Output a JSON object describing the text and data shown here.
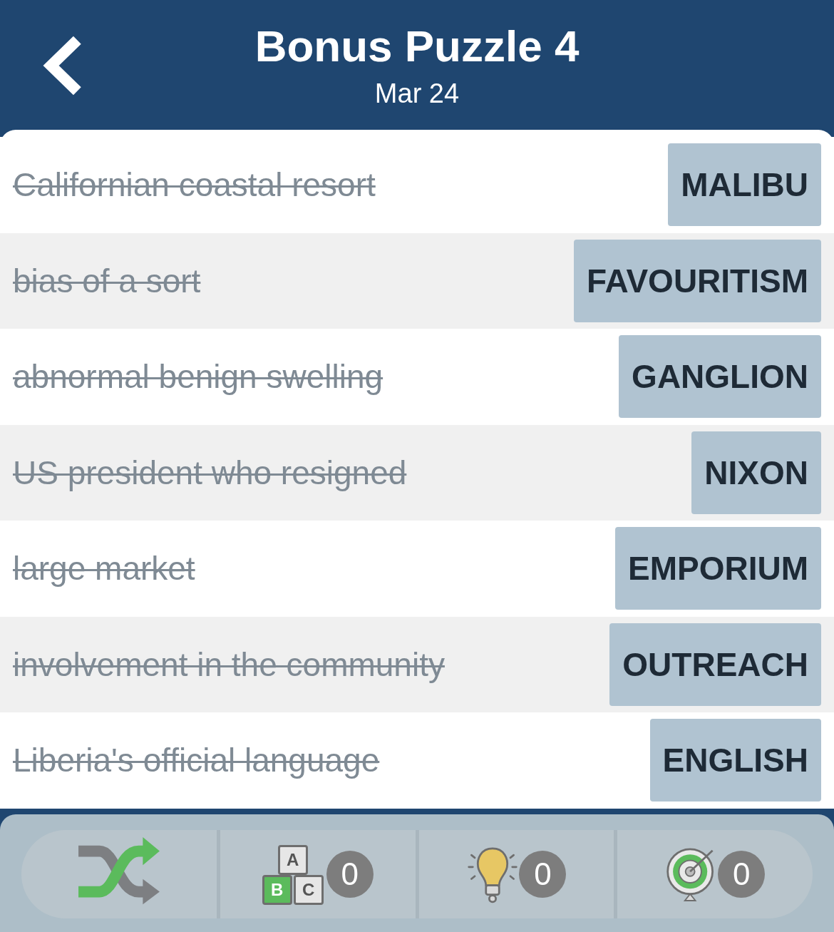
{
  "header": {
    "title": "Bonus Puzzle 4",
    "date": "Mar 24"
  },
  "clues": [
    {
      "clue": "Californian coastal resort",
      "answer": "MALIBU",
      "solved": true
    },
    {
      "clue": "bias of a sort",
      "answer": "FAVOURITISM",
      "solved": true
    },
    {
      "clue": "abnormal benign swelling",
      "answer": "GANGLION",
      "solved": true
    },
    {
      "clue": "US president who resigned",
      "answer": "NIXON",
      "solved": true
    },
    {
      "clue": "large market",
      "answer": "EMPORIUM",
      "solved": true
    },
    {
      "clue": "involvement in the community",
      "answer": "OUTREACH",
      "solved": true
    },
    {
      "clue": "Liberia's official language",
      "answer": "ENGLISH",
      "solved": true
    }
  ],
  "toolbar": [
    {
      "kind": "shuffle"
    },
    {
      "kind": "letters",
      "letters": [
        "A",
        "B",
        "C"
      ],
      "count": "0"
    },
    {
      "kind": "hint",
      "count": "0"
    },
    {
      "kind": "target",
      "count": "0"
    }
  ]
}
